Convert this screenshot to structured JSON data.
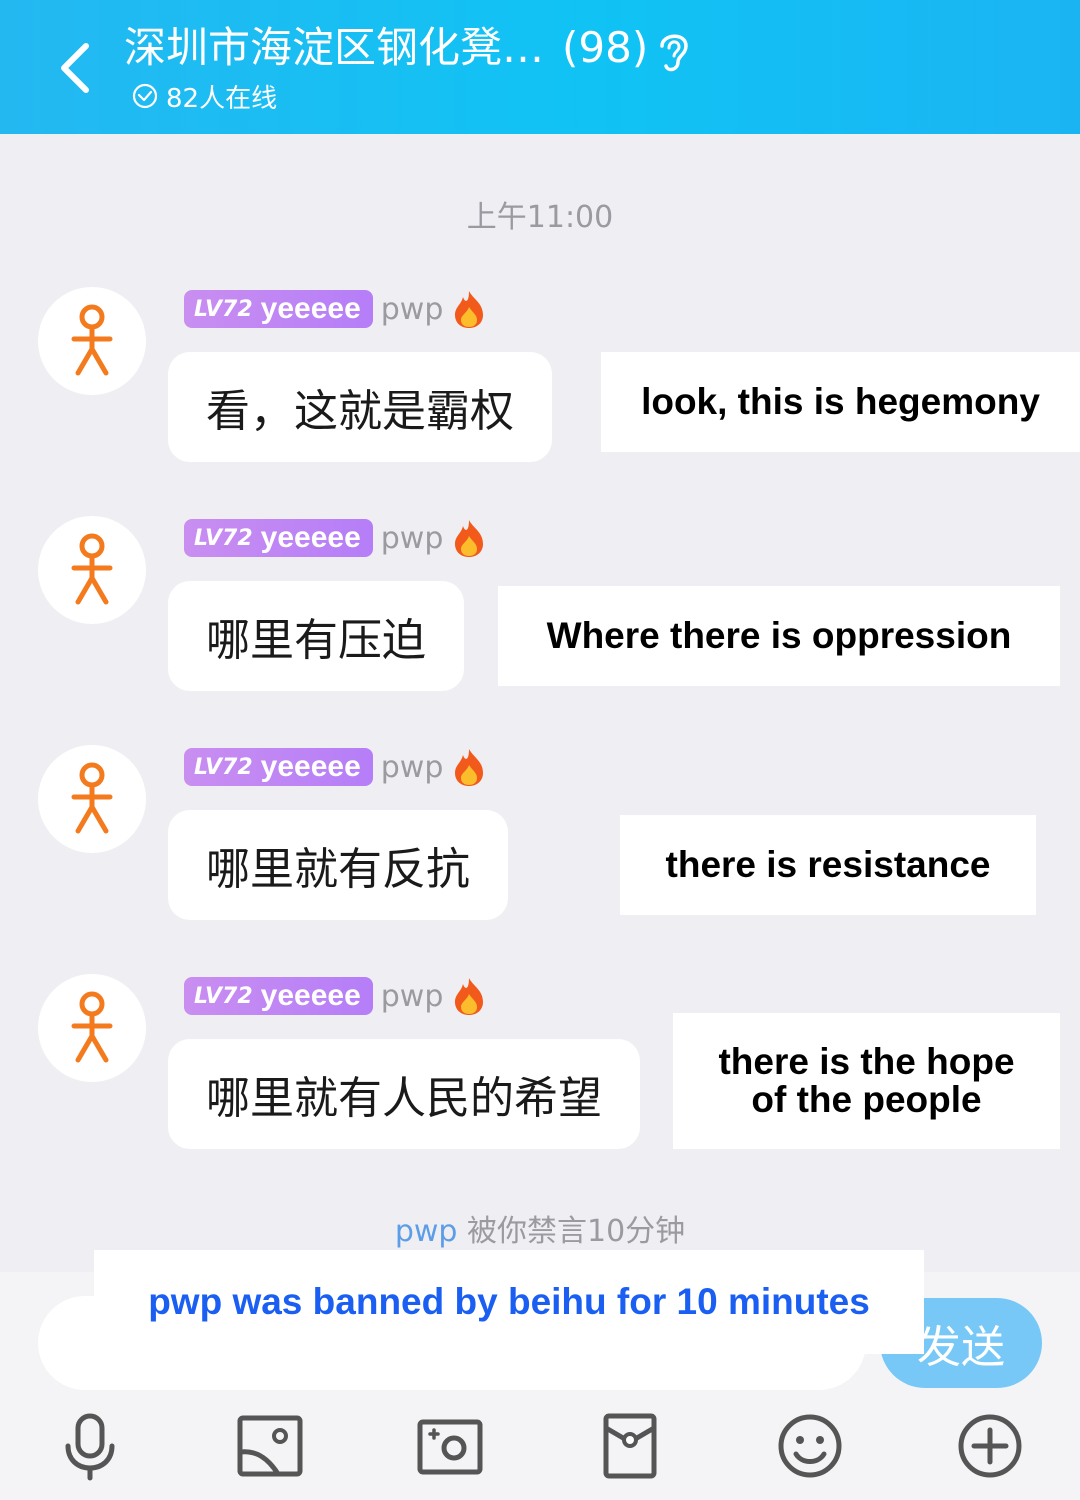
{
  "header": {
    "title": "深圳市海淀区钢化凳…",
    "member_count": "(98)",
    "online": "82人在线",
    "accent_color": "#1dbcf4"
  },
  "timestamp": "上午11:00",
  "messages": [
    {
      "level": "LV72",
      "nickname": "yeeeee",
      "sender": "pwp",
      "text": "看，这就是霸权",
      "caption": "look, this is hegemony"
    },
    {
      "level": "LV72",
      "nickname": "yeeeee",
      "sender": "pwp",
      "text": "哪里有压迫",
      "caption": "Where there is oppression"
    },
    {
      "level": "LV72",
      "nickname": "yeeeee",
      "sender": "pwp",
      "text": "哪里就有反抗",
      "caption": "there is resistance"
    },
    {
      "level": "LV72",
      "nickname": "yeeeee",
      "sender": "pwp",
      "text": "哪里就有人民的希望",
      "caption_line1": "there is the hope",
      "caption_line2": "of the people"
    }
  ],
  "notice": {
    "user": "pwp",
    "text": "被你禁言10分钟",
    "caption": "pwp was banned by beihu for 10 minutes"
  },
  "input": {
    "placeholder": "",
    "send_label": "发送"
  },
  "toolbar": {
    "icons": [
      "microphone-icon",
      "image-icon",
      "camera-icon",
      "red-packet-icon",
      "emoji-icon",
      "plus-icon"
    ]
  }
}
